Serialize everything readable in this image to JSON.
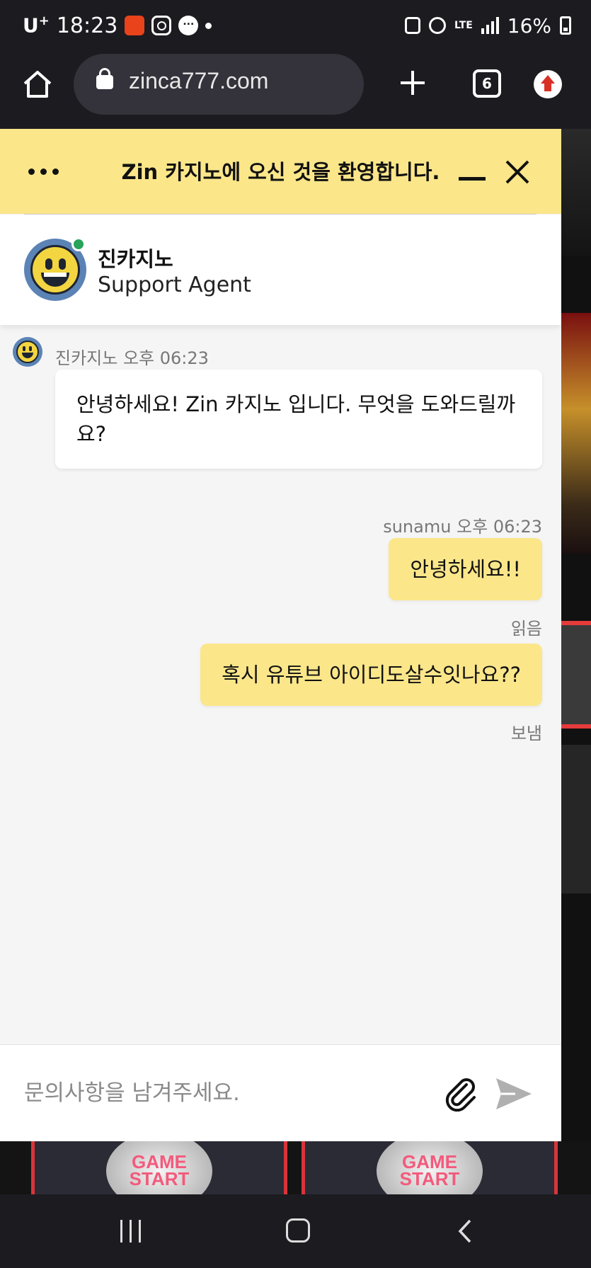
{
  "status_bar": {
    "carrier": "U",
    "carrier_sup": "+",
    "time": "18:23",
    "lte": "LTE",
    "battery": "16%",
    "icons": [
      "aliexpress-icon",
      "instagram-icon",
      "messenger-icon",
      "notification-dot-icon",
      "alarm-icon",
      "lte-icon",
      "signal-icon",
      "battery-icon"
    ]
  },
  "browser": {
    "url": "zinca777.com",
    "tab_count": "6"
  },
  "chat": {
    "header_title": "Zin 카지노에 오신 것을 환영합니다.",
    "agent": {
      "name": "진카지노",
      "role": "Support Agent",
      "online_color": "#27a35a"
    },
    "messages": [
      {
        "sender": "진카지노",
        "meta": "진카지노 오후 06:23",
        "text": "안녕하세요! Zin 카지노 입니다. 무엇을 도와드릴까요?"
      },
      {
        "sender": "sunamu",
        "meta": "sunamu 오후 06:23",
        "text": "안녕하세요!!",
        "status": "읽음"
      },
      {
        "sender": "sunamu",
        "text": "혹시 유튜브 아이디도살수잇나요??",
        "status": "보냄"
      }
    ],
    "input_placeholder": "문의사항을 남겨주세요.",
    "colors": {
      "header_bg": "#fbe68a",
      "user_bubble": "#fbe68a",
      "agent_bubble": "#ffffff"
    }
  },
  "background_site": {
    "game_button_label": "GAME START"
  }
}
